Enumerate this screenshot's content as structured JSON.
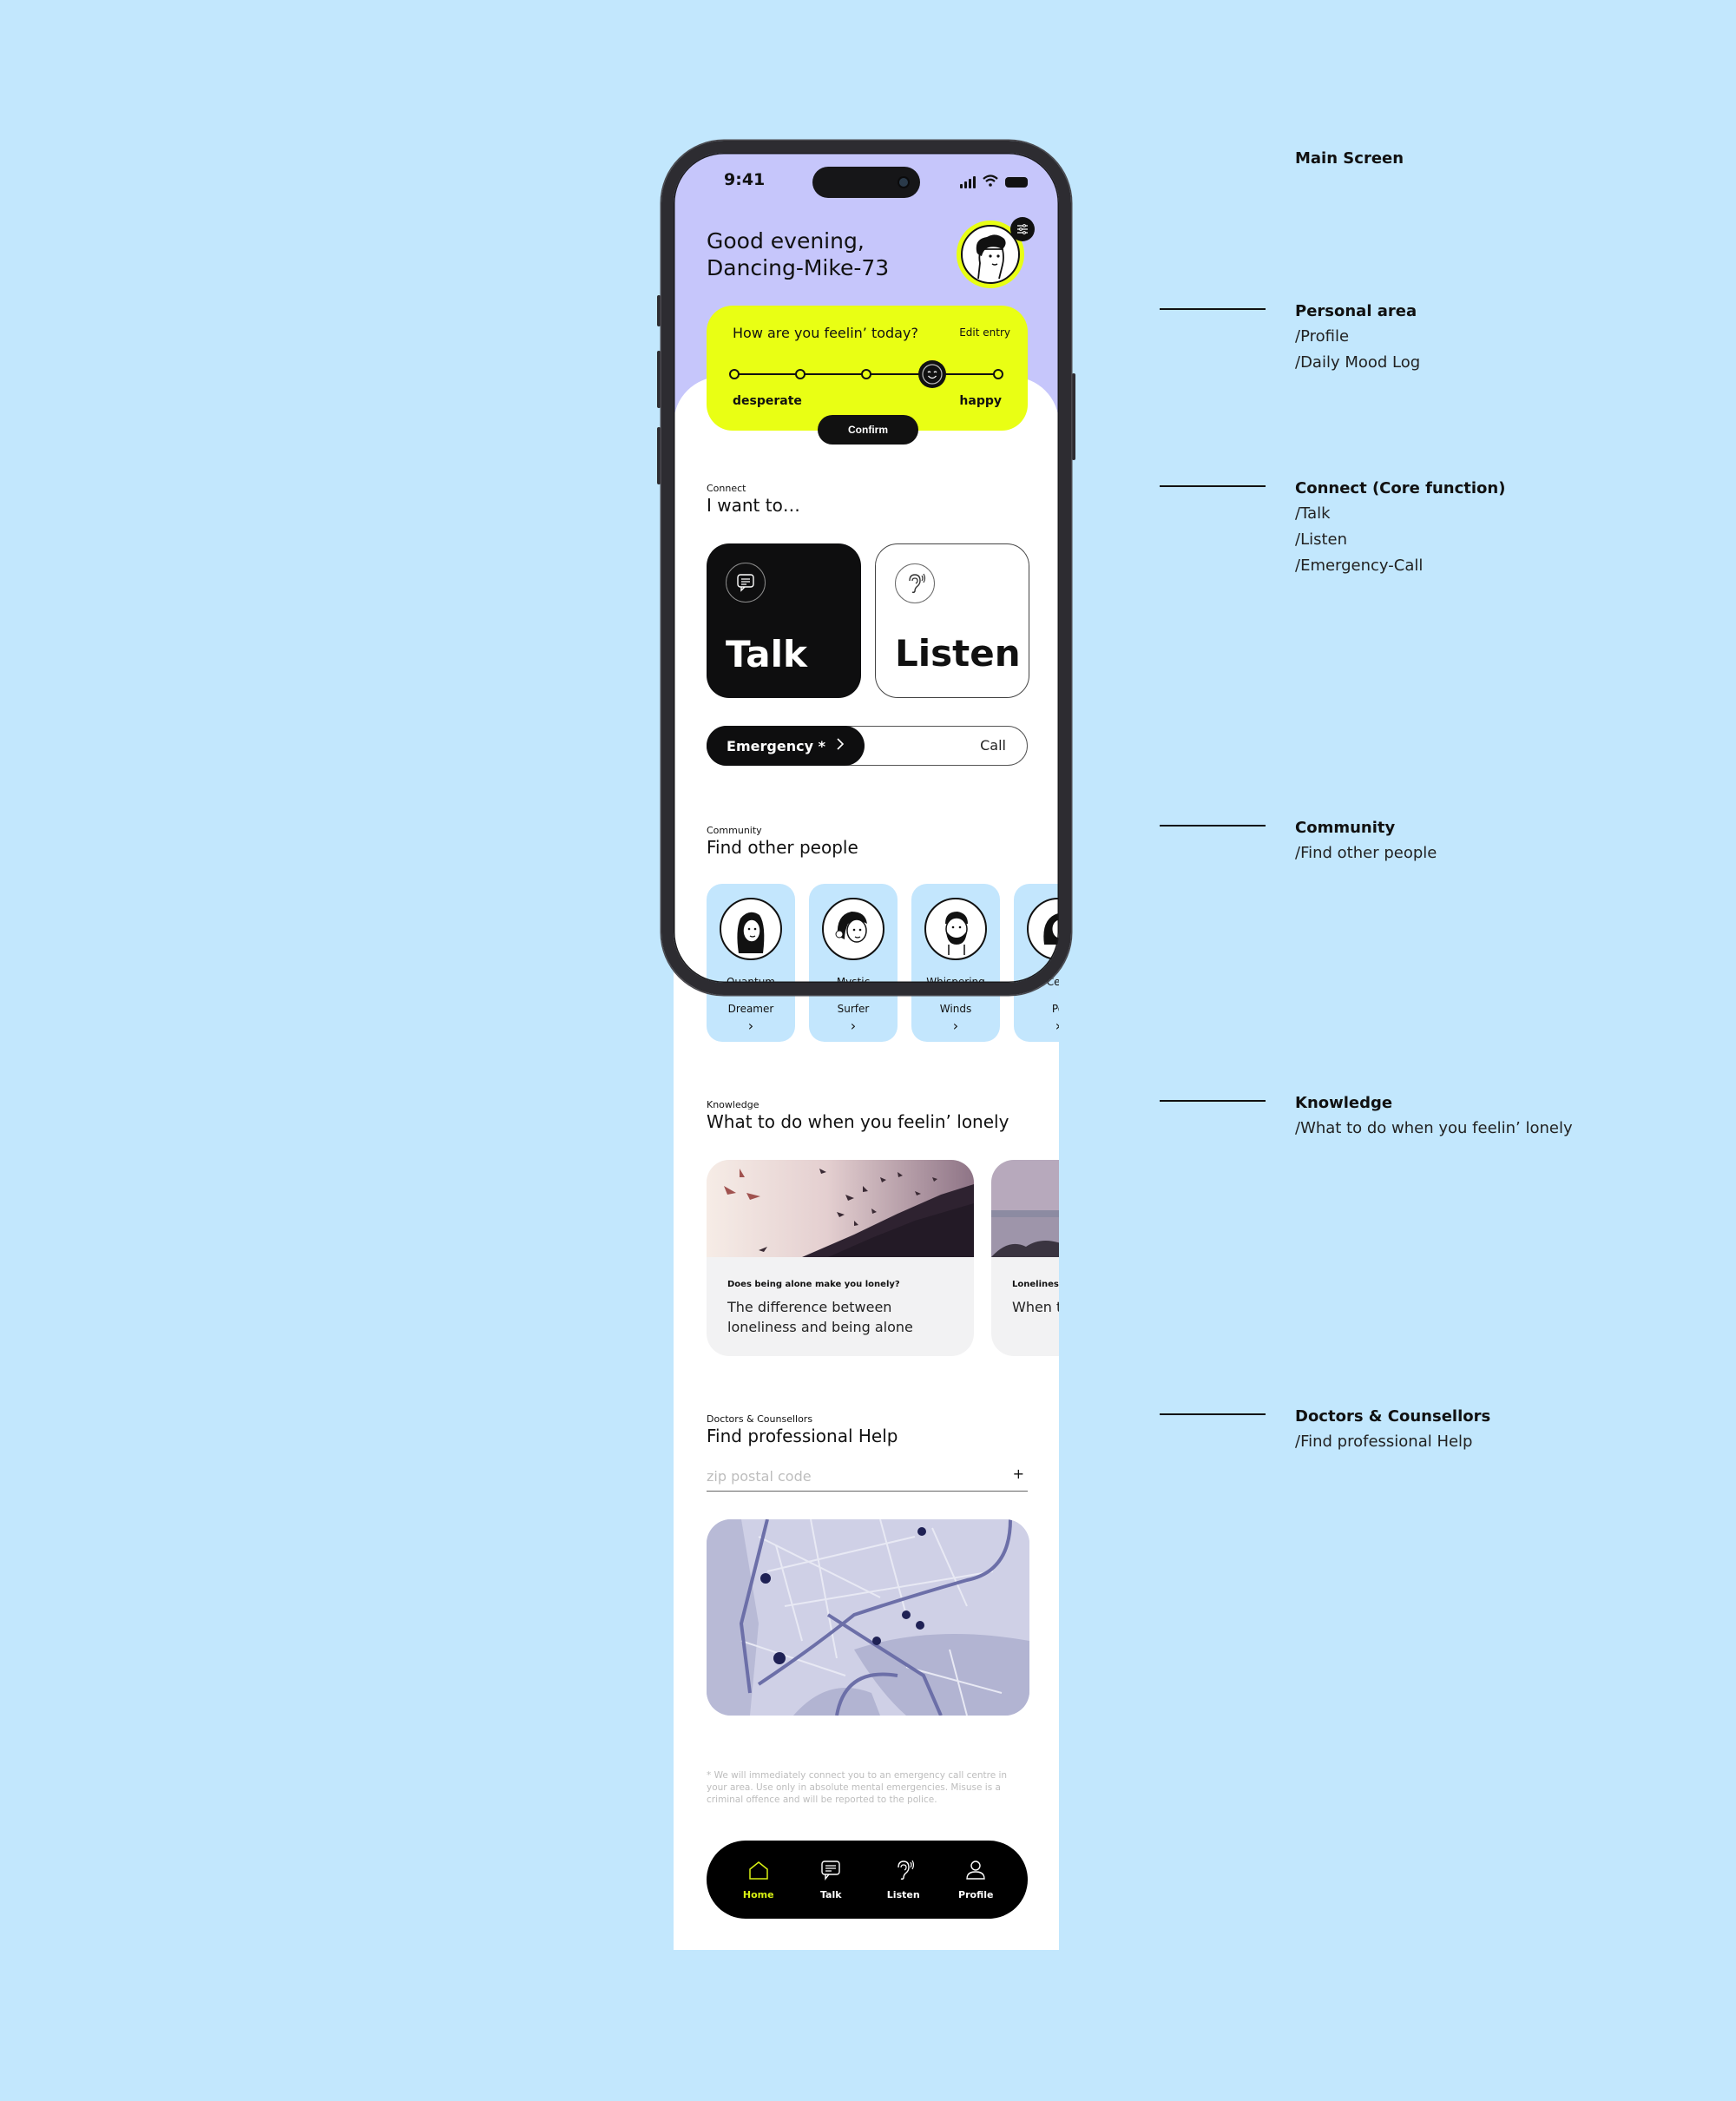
{
  "status_bar": {
    "time": "9:41"
  },
  "header": {
    "greeting_line1": "Good evening,",
    "greeting_line2": "Dancing-Mike-73"
  },
  "mood": {
    "question": "How are you feelin’ today?",
    "edit_label": "Edit entry",
    "low_label": "desperate",
    "high_label": "happy",
    "scale_steps": 5,
    "selected_step": 4,
    "confirm_label": "Confirm"
  },
  "connect": {
    "kicker": "Connect",
    "title": "I want to…",
    "talk_label": "Talk",
    "listen_label": "Listen",
    "emergency_label": "Emergency *",
    "call_label": "Call"
  },
  "community": {
    "kicker": "Community",
    "title": "Find other people",
    "people": [
      {
        "line1": "Quantum",
        "line2": "Dreamer"
      },
      {
        "line1": "Mystic",
        "line2": "Surfer"
      },
      {
        "line1": "Whispering",
        "line2": "Winds"
      },
      {
        "line1": "Cele",
        "line2": "Po"
      }
    ]
  },
  "knowledge": {
    "kicker": "Knowledge",
    "title": "What to do when you feelin’ lonely",
    "articles": [
      {
        "kicker": "Does being alone make you lonely?",
        "title": "The difference between loneliness and being alone"
      },
      {
        "kicker": "Loneliness",
        "title": "When t your life"
      }
    ]
  },
  "doctors": {
    "kicker": "Doctors & Counsellors",
    "title": "Find professional Help",
    "zip_placeholder": "zip postal code",
    "zip_value": "",
    "add_symbol": "+"
  },
  "disclaimer": "* We will immediately connect you to an emergency call centre in your area. Use only in absolute mental emergencies. Misuse is a criminal offence and will be reported to the police.",
  "tabbar": {
    "items": [
      {
        "label": "Home",
        "icon": "home-icon",
        "active": true
      },
      {
        "label": "Talk",
        "icon": "chat-icon",
        "active": false
      },
      {
        "label": "Listen",
        "icon": "ear-icon",
        "active": false
      },
      {
        "label": "Profile",
        "icon": "person-icon",
        "active": false
      }
    ],
    "active_color": "#d8f013"
  },
  "colors": {
    "background": "#c2e7fd",
    "hero": "#c6c6fb",
    "accent_yellow": "#e9ff14",
    "card_blue": "#c3e6fd",
    "ink": "#0e0e0f"
  },
  "annotations": [
    {
      "title": "Main Screen",
      "items": []
    },
    {
      "title": "Personal area",
      "items": [
        "/Profile",
        "/Daily Mood Log"
      ]
    },
    {
      "title": "Connect (Core function)",
      "items": [
        "/Talk",
        "/Listen",
        "/Emergency-Call"
      ]
    },
    {
      "title": "Community",
      "items": [
        "/Find other people"
      ]
    },
    {
      "title": "Knowledge",
      "items": [
        "/What to do when you feelin’ lonely"
      ]
    },
    {
      "title": "Doctors & Counsellors",
      "items": [
        "/Find professional Help"
      ]
    }
  ]
}
